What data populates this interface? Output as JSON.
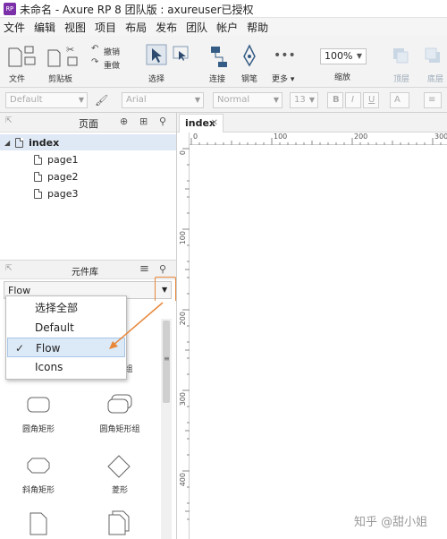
{
  "window": {
    "title": "未命名 - Axure RP 8 团队版 : axureuser已授权",
    "app_icon_text": "RP"
  },
  "menu": [
    "文件",
    "编辑",
    "视图",
    "项目",
    "布局",
    "发布",
    "团队",
    "帐户",
    "帮助"
  ],
  "toolbar": {
    "file": "文件",
    "clipboard": "剪贴板",
    "undo": "撤销",
    "redo": "重做",
    "select": "选择",
    "connect": "连接",
    "pen": "钢笔",
    "more": "更多 ▾",
    "zoom_value": "100%",
    "zoom_label": "缩放",
    "top": "顶层",
    "bottom": "底层"
  },
  "stylebar": {
    "style": "Default",
    "font": "Arial",
    "weight": "Normal",
    "size": "13",
    "bold": "B",
    "italic": "I",
    "underline": "U"
  },
  "pages_panel": {
    "title": "页面",
    "root": "index",
    "children": [
      "page1",
      "page2",
      "page3"
    ]
  },
  "library_panel": {
    "title": "元件库",
    "selected": "Flow",
    "dropdown_options": [
      "选择全部",
      "Default",
      "Flow",
      "Icons"
    ],
    "widgets": [
      "组",
      "圆角矩形",
      "圆角矩形组",
      "斜角矩形",
      "菱形"
    ]
  },
  "canvas": {
    "tab": "index",
    "ruler_top": [
      "0",
      "100",
      "200",
      "300"
    ],
    "ruler_left": [
      "0",
      "100",
      "200",
      "300",
      "400"
    ]
  },
  "colors": {
    "accent": "#e8873a",
    "selection": "#dce9f7",
    "app_icon": "#7b2fa8"
  },
  "watermark": "知乎 @甜小姐"
}
